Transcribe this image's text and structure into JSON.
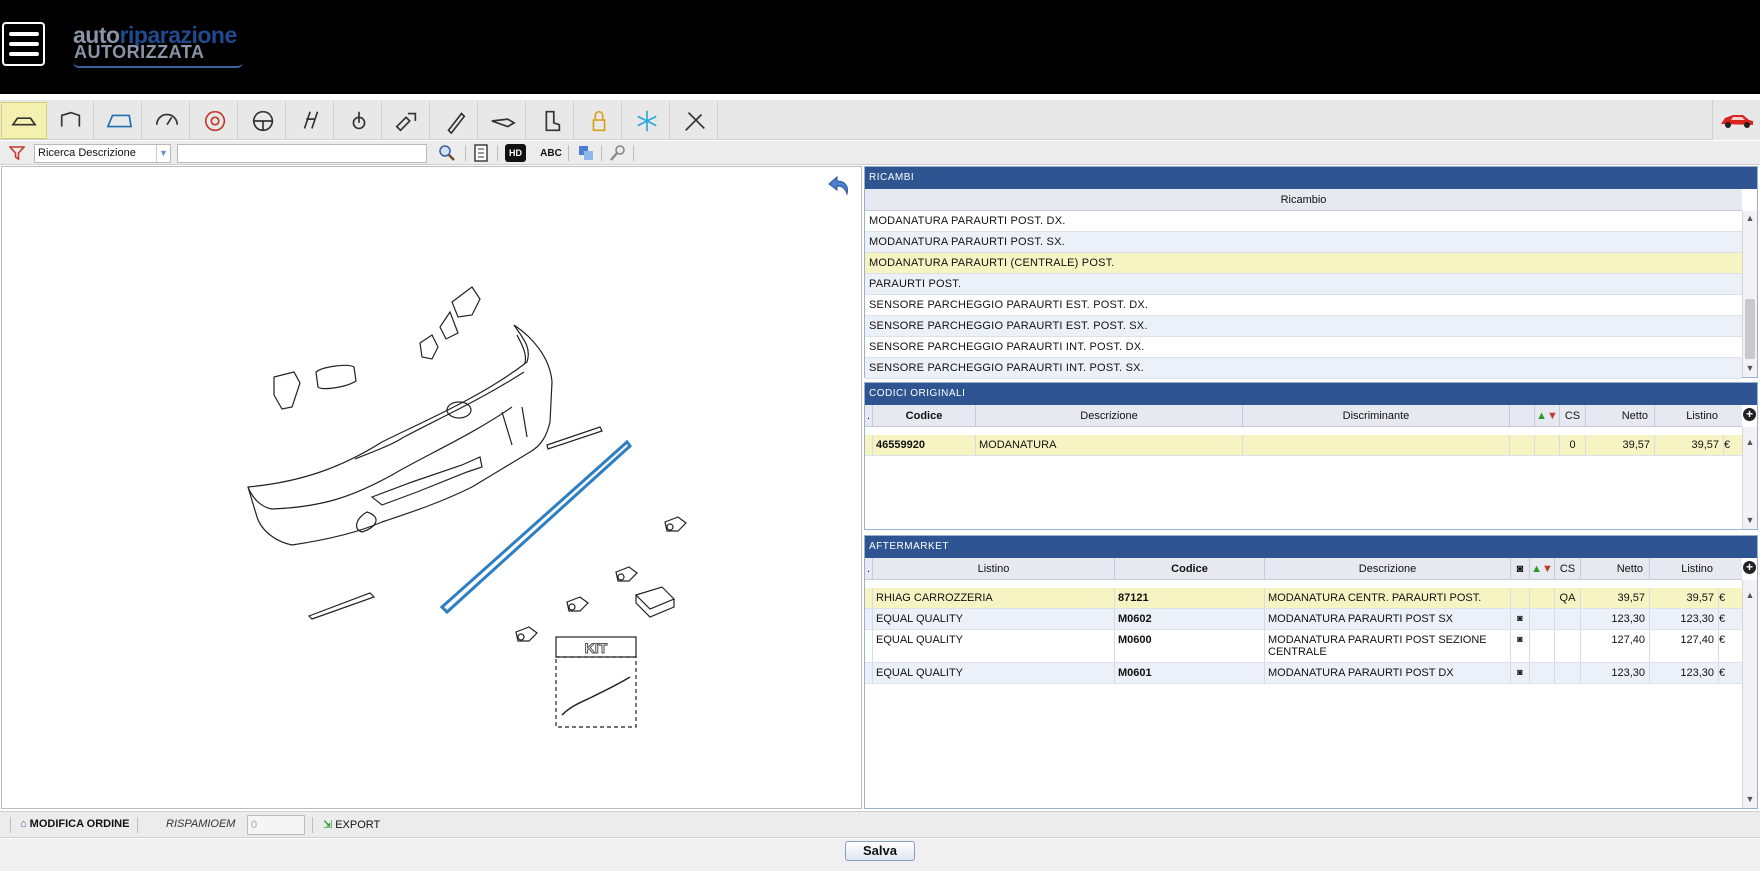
{
  "header": {
    "logo_text_1": "auto",
    "logo_text_2": "riparazione",
    "logo_text_3": "AUTORIZZATA"
  },
  "categories": [
    {
      "name": "body-icon"
    },
    {
      "name": "interior-icon"
    },
    {
      "name": "glass-icon"
    },
    {
      "name": "dashboard-icon"
    },
    {
      "name": "brake-icon"
    },
    {
      "name": "steering-wheel-icon"
    },
    {
      "name": "suspension-icon"
    },
    {
      "name": "gearshift-icon"
    },
    {
      "name": "engine-parts-icon"
    },
    {
      "name": "paint-pencil-icon"
    },
    {
      "name": "exhaust-icon"
    },
    {
      "name": "seat-icon"
    },
    {
      "name": "lock-icon"
    },
    {
      "name": "ac-snowflake-icon"
    },
    {
      "name": "tools-icon"
    }
  ],
  "search": {
    "mode": "Ricerca Descrizione",
    "query": "",
    "hd_label": "HD",
    "abc_label": "ABC"
  },
  "ricambi": {
    "title": "RICAMBI",
    "column": "Ricambio",
    "rows": [
      "MODANATURA PARAURTI POST. DX.",
      "MODANATURA PARAURTI POST. SX.",
      "MODANATURA PARAURTI (CENTRALE) POST.",
      "PARAURTI POST.",
      "SENSORE PARCHEGGIO PARAURTI EST. POST. DX.",
      "SENSORE PARCHEGGIO PARAURTI EST. POST. SX.",
      "SENSORE PARCHEGGIO PARAURTI INT. POST. DX.",
      "SENSORE PARCHEGGIO PARAURTI INT. POST. SX."
    ]
  },
  "codici": {
    "title": "CODICI ORIGINALI",
    "columns": {
      "dot": ".",
      "codice": "Codice",
      "descrizione": "Descrizione",
      "discriminante": "Discriminante",
      "cs": "CS",
      "netto": "Netto",
      "listino": "Listino"
    },
    "rows": [
      {
        "codice": "46559920",
        "descrizione": "MODANATURA",
        "discriminante": "",
        "cs": "0",
        "netto": "39,57",
        "listino": "39,57",
        "valuta": "€"
      }
    ]
  },
  "aftermarket": {
    "title": "AFTERMARKET",
    "columns": {
      "dot": ".",
      "listino": "Listino",
      "codice": "Codice",
      "descrizione": "Descrizione",
      "cs": "CS",
      "netto": "Netto",
      "listino2": "Listino"
    },
    "rows": [
      {
        "listino": "RHIAG CARROZZERIA",
        "codice": "87121",
        "descrizione": "MODANATURA CENTR. PARAURTI POST.",
        "cs": "QA",
        "netto": "39,57",
        "listino2": "39,57",
        "valuta": "€"
      },
      {
        "listino": "EQUAL QUALITY",
        "codice": "M0602",
        "descrizione": "MODANATURA PARAURTI POST SX",
        "cs": "",
        "netto": "123,30",
        "listino2": "123,30",
        "valuta": "€"
      },
      {
        "listino": "EQUAL QUALITY",
        "codice": "M0600",
        "descrizione": "MODANATURA PARAURTI POST SEZIONE CENTRALE",
        "cs": "",
        "netto": "127,40",
        "listino2": "127,40",
        "valuta": "€"
      },
      {
        "listino": "EQUAL QUALITY",
        "codice": "M0601",
        "descrizione": "MODANATURA PARAURTI POST DX",
        "cs": "",
        "netto": "123,30",
        "listino2": "123,30",
        "valuta": "€"
      }
    ]
  },
  "drawing": {
    "kit_label": "KIT"
  },
  "bottom": {
    "modifica_ordine": "MODIFICA ORDINE",
    "risparmio_label": "RISPAMIOEM",
    "risparmio_value": "0",
    "export": "EXPORT",
    "save": "Salva"
  }
}
